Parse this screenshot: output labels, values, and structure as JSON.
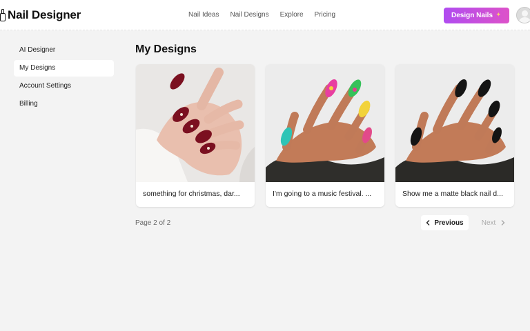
{
  "header": {
    "brand": "Nail Designer",
    "brand_icon": "nail-polish-icon",
    "nav": [
      "Nail Ideas",
      "Nail Designs",
      "Explore",
      "Pricing"
    ],
    "cta_label": "Design Nails",
    "cta_icon": "sparkle-icon",
    "avatar_icon": "user-avatar-icon"
  },
  "sidebar": {
    "items": [
      {
        "label": "AI Designer",
        "active": false
      },
      {
        "label": "My Designs",
        "active": true
      },
      {
        "label": "Account Settings",
        "active": false
      },
      {
        "label": "Billing",
        "active": false
      }
    ]
  },
  "main": {
    "title": "My Designs",
    "cards": [
      {
        "caption": "something for christmas, dar..."
      },
      {
        "caption": "I'm going to a music festival. ..."
      },
      {
        "caption": "Show me a matte black nail d..."
      }
    ],
    "pagination": {
      "status": "Page 2 of 2",
      "prev_label": "Previous",
      "next_label": "Next"
    }
  },
  "colors": {
    "accent_start": "#b04cf0",
    "accent_end": "#dd52c9",
    "background": "#f3f3f3"
  }
}
